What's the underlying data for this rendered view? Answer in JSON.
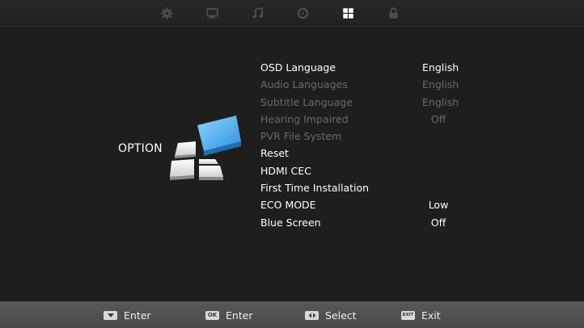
{
  "tabs": [
    {
      "icon": "gear-icon",
      "label": "Picture"
    },
    {
      "icon": "monitor-icon",
      "label": "Channel"
    },
    {
      "icon": "music-note-icon",
      "label": "Sound"
    },
    {
      "icon": "clock-icon",
      "label": "Time"
    },
    {
      "icon": "grid-icon",
      "label": "Option",
      "active": true
    },
    {
      "icon": "lock-icon",
      "label": "Lock"
    }
  ],
  "section": {
    "title": "OPTION",
    "icon": "option-blocks-icon"
  },
  "menu": {
    "items": [
      {
        "label": "OSD Language",
        "value": "English",
        "enabled": true
      },
      {
        "label": "Audio Languages",
        "value": "English",
        "enabled": false
      },
      {
        "label": "Subtitle Language",
        "value": "English",
        "enabled": false
      },
      {
        "label": "Hearing Impaired",
        "value": "Off",
        "enabled": false
      },
      {
        "label": "PVR File System",
        "value": "",
        "enabled": false
      },
      {
        "label": "Reset",
        "value": "",
        "enabled": true
      },
      {
        "label": "HDMI CEC",
        "value": "",
        "enabled": true
      },
      {
        "label": "First Time Installation",
        "value": "",
        "enabled": true
      },
      {
        "label": "ECO MODE",
        "value": "Low",
        "enabled": true
      },
      {
        "label": "Blue Screen",
        "value": "Off",
        "enabled": true
      }
    ]
  },
  "footer": {
    "hints": [
      {
        "key": "down-arrow",
        "key_text": "",
        "label": "Enter"
      },
      {
        "key": "ok",
        "key_text": "OK",
        "label": "Enter"
      },
      {
        "key": "left-right",
        "key_text": "",
        "label": "Select"
      },
      {
        "key": "exit",
        "key_text": "EXIT",
        "label": "Exit"
      }
    ]
  },
  "colors": {
    "background": "#1e1e1e",
    "active_text": "#ffffff",
    "disabled_text": "#6a6a6a",
    "inactive_tab_icon": "#4e4e4e",
    "footer_bar": "#505050",
    "accent_blue": "#3aa8ee"
  }
}
